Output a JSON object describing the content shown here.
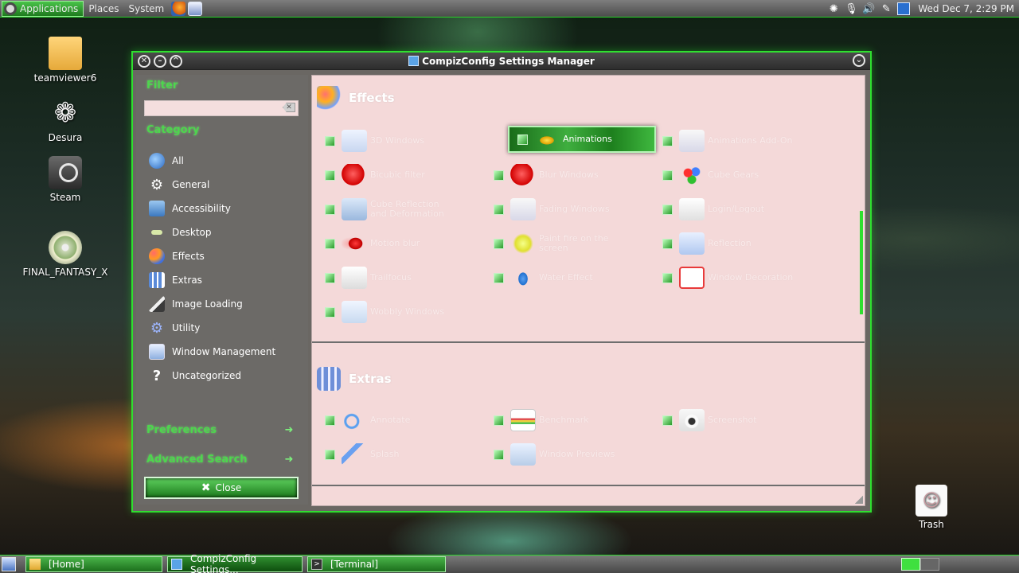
{
  "top_panel": {
    "menus": [
      "Applications",
      "Places",
      "System"
    ],
    "clock": "Wed Dec  7,  2:29 PM"
  },
  "desktop_icons": [
    {
      "label": "teamviewer6",
      "icon": "folder-icon"
    },
    {
      "label": "Desura",
      "icon": "desura-icon"
    },
    {
      "label": "Steam",
      "icon": "steam-icon"
    },
    {
      "label": "FINAL_FANTASY_X",
      "icon": "disc-icon"
    },
    {
      "label": "Trash",
      "icon": "trash-icon"
    }
  ],
  "window": {
    "title": "CompizConfig Settings Manager",
    "sidebar": {
      "filter_label": "Filter",
      "filter_value": "",
      "category_label": "Category",
      "categories": [
        {
          "label": "All",
          "icon": "globe-icon"
        },
        {
          "label": "General",
          "icon": "gear-icon"
        },
        {
          "label": "Accessibility",
          "icon": "accessibility-icon"
        },
        {
          "label": "Desktop",
          "icon": "desktop-icon"
        },
        {
          "label": "Effects",
          "icon": "effects-icon"
        },
        {
          "label": "Extras",
          "icon": "extras-icon"
        },
        {
          "label": "Image Loading",
          "icon": "image-loading-icon"
        },
        {
          "label": "Utility",
          "icon": "utility-icon"
        },
        {
          "label": "Window Management",
          "icon": "window-management-icon"
        },
        {
          "label": "Uncategorized",
          "icon": "question-icon"
        }
      ],
      "preferences_label": "Preferences",
      "advanced_search_label": "Advanced Search",
      "close_label": "Close"
    },
    "groups": [
      {
        "title": "Effects",
        "plugins": [
          {
            "label": "3D Windows",
            "checked": true,
            "icon": "3d-windows-icon"
          },
          {
            "label": "Animations",
            "checked": true,
            "icon": "animations-icon",
            "selected": true
          },
          {
            "label": "Animations Add-On",
            "checked": true,
            "icon": "animations-addon-icon"
          },
          {
            "label": "Bicubic filter",
            "checked": true,
            "icon": "bicubic-icon"
          },
          {
            "label": "Blur Windows",
            "checked": true,
            "icon": "blur-icon"
          },
          {
            "label": "Cube Gears",
            "checked": true,
            "icon": "cube-gears-icon"
          },
          {
            "label": "Cube Reflection and Deformation",
            "checked": true,
            "icon": "cube-reflection-icon"
          },
          {
            "label": "Fading Windows",
            "checked": true,
            "icon": "fading-icon"
          },
          {
            "label": "Login/Logout",
            "checked": true,
            "icon": "login-logout-icon"
          },
          {
            "label": "Motion blur",
            "checked": true,
            "icon": "motion-blur-icon"
          },
          {
            "label": "Paint fire on the screen",
            "checked": true,
            "icon": "fire-icon"
          },
          {
            "label": "Reflection",
            "checked": true,
            "icon": "reflection-icon"
          },
          {
            "label": "Trailfocus",
            "checked": true,
            "icon": "trailfocus-icon"
          },
          {
            "label": "Water Effect",
            "checked": true,
            "icon": "water-icon"
          },
          {
            "label": "Window Decoration",
            "checked": true,
            "icon": "window-decoration-icon"
          },
          {
            "label": "Wobbly Windows",
            "checked": true,
            "icon": "wobbly-icon"
          }
        ]
      },
      {
        "title": "Extras",
        "plugins": [
          {
            "label": "Annotate",
            "checked": true,
            "icon": "annotate-icon"
          },
          {
            "label": "Benchmark",
            "checked": true,
            "icon": "benchmark-icon"
          },
          {
            "label": "Screenshot",
            "checked": true,
            "icon": "screenshot-icon"
          },
          {
            "label": "Splash",
            "checked": true,
            "icon": "splash-icon"
          },
          {
            "label": "Window Previews",
            "checked": true,
            "icon": "window-previews-icon"
          }
        ]
      }
    ]
  },
  "taskbar": {
    "tasks": [
      {
        "label": "[Home]",
        "icon": "folder-icon"
      },
      {
        "label": "CompizConfig Settings...",
        "icon": "ccsm-icon",
        "active": true
      },
      {
        "label": "[Terminal]",
        "icon": "terminal-icon"
      }
    ]
  },
  "colors": {
    "accent": "#2fe02f",
    "content_bg": "#f4d9d9",
    "sidebar_bg": "#6c6a67",
    "selected_plugin": "#3fae3f"
  }
}
